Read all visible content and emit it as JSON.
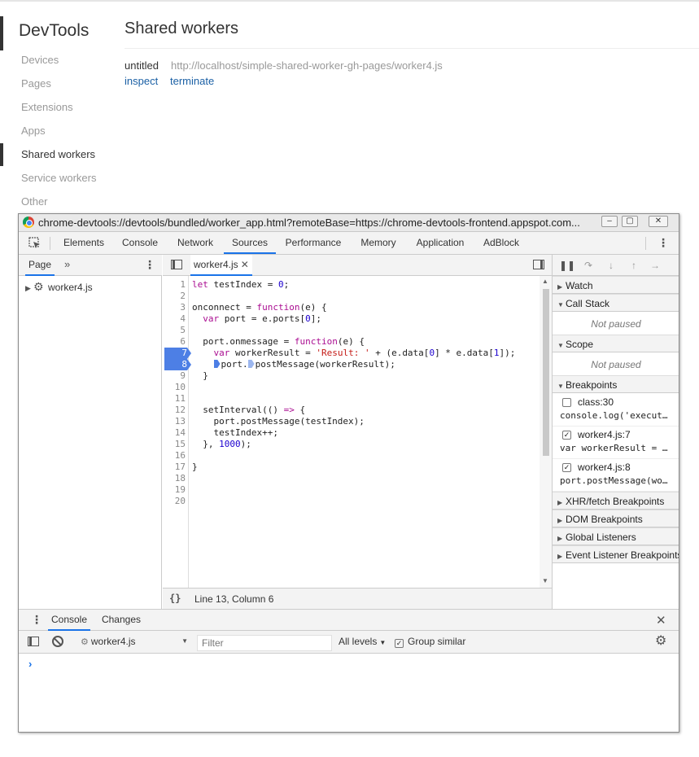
{
  "outer_page": {
    "app_title": "DevTools",
    "nav_items": [
      {
        "label": "Devices",
        "selected": false
      },
      {
        "label": "Pages",
        "selected": false
      },
      {
        "label": "Extensions",
        "selected": false
      },
      {
        "label": "Apps",
        "selected": false
      },
      {
        "label": "Shared workers",
        "selected": true
      },
      {
        "label": "Service workers",
        "selected": false
      },
      {
        "label": "Other",
        "selected": false
      }
    ],
    "section_title": "Shared workers",
    "worker": {
      "name": "untitled",
      "url": "http://localhost/simple-shared-worker-gh-pages/worker4.js",
      "actions": [
        "inspect",
        "terminate"
      ]
    }
  },
  "devtools_window": {
    "title": "chrome-devtools://devtools/bundled/worker_app.html?remoteBase=https://chrome-devtools-frontend.appspot.com...",
    "window_buttons": [
      "minimize-icon",
      "maximize-icon",
      "close-icon"
    ],
    "panel_tabs": [
      {
        "label": "Elements",
        "active": false
      },
      {
        "label": "Console",
        "active": false
      },
      {
        "label": "Network",
        "active": false
      },
      {
        "label": "Sources",
        "active": true
      },
      {
        "label": "Performance",
        "active": false
      },
      {
        "label": "Memory",
        "active": false
      },
      {
        "label": "Application",
        "active": false
      },
      {
        "label": "AdBlock",
        "active": false
      }
    ],
    "navigator": {
      "tab": "Page",
      "more_icon": "»",
      "files": [
        {
          "label": "worker4.js",
          "icon": "gear-icon"
        }
      ]
    },
    "editor": {
      "open_file": "worker4.js",
      "line_numbers": [
        "1",
        "2",
        "3",
        "4",
        "5",
        "6",
        "7",
        "8",
        "9",
        "10",
        "11",
        "12",
        "13",
        "14",
        "15",
        "16",
        "17",
        "18",
        "19",
        "20"
      ],
      "breakpoint_lines": [
        "7",
        "8"
      ],
      "code_lines": [
        "let testIndex = 0;",
        "",
        "onconnect = function(e) {",
        "  var port = e.ports[0];",
        "",
        "  port.onmessage = function(e) {",
        "    var workerResult = 'Result: ' + (e.data[0] * e.data[1]);",
        "    port.postMessage(workerResult);",
        "  }",
        "",
        "",
        "  setInterval(() => {",
        "    port.postMessage(testIndex);",
        "    testIndex++;",
        "  }, 1000);",
        "",
        "}",
        "",
        "",
        ""
      ],
      "status": "Line 13, Column 6",
      "pretty_print_label": "{}"
    },
    "debugger": {
      "toolbar_buttons": [
        "pause-icon",
        "step-over-icon",
        "step-into-icon",
        "step-out-icon",
        "step-icon"
      ],
      "sections": {
        "watch": "Watch",
        "call_stack": "Call Stack",
        "call_stack_body": "Not paused",
        "scope": "Scope",
        "scope_body": "Not paused",
        "breakpoints": "Breakpoints",
        "xhr": "XHR/fetch Breakpoints",
        "dom": "DOM Breakpoints",
        "global": "Global Listeners",
        "event": "Event Listener Breakpoints"
      },
      "breakpoints": [
        {
          "label": "class:30",
          "code": "console.log('execut…",
          "checked": false
        },
        {
          "label": "worker4.js:7",
          "code": "var workerResult = …",
          "checked": true
        },
        {
          "label": "worker4.js:8",
          "code": "port.postMessage(wo…",
          "checked": true
        }
      ]
    },
    "drawer": {
      "tabs": [
        {
          "label": "Console",
          "active": true
        },
        {
          "label": "Changes",
          "active": false
        }
      ],
      "context": "worker4.js",
      "filter_placeholder": "Filter",
      "levels": "All levels",
      "group_similar": "Group similar",
      "group_similar_checked": true,
      "prompt": "›"
    }
  },
  "colors": {
    "accent": "#1a73e8",
    "breakpoint": "#4d7fe5",
    "link": "#1b60a5"
  }
}
